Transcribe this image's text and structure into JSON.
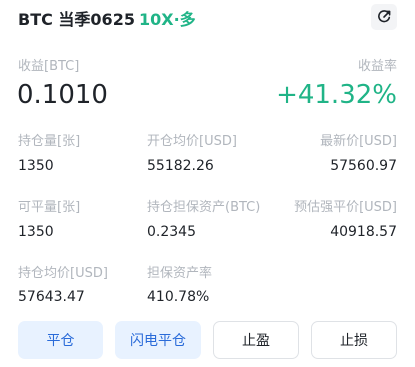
{
  "header": {
    "contract": "BTC 当季0625",
    "tag": "10X·多",
    "share_icon": "share-icon"
  },
  "pnl": {
    "label": "收益[BTC]",
    "value": "0.1010",
    "rate_label": "收益率",
    "rate_value": "+41.32%"
  },
  "row1": {
    "position_label": "持仓量[张]",
    "position_value": "1350",
    "avg_open_label": "开仓均价[USD]",
    "avg_open_value": "55182.26",
    "last_label": "最新价[USD]",
    "last_value": "57560.97"
  },
  "row2": {
    "closable_label": "可平量[张]",
    "closable_value": "1350",
    "margin_label": "持仓担保资产(BTC)",
    "margin_value": "0.2345",
    "liq_label": "预估强平价[USD]",
    "liq_value": "40918.57"
  },
  "row3": {
    "hold_avg_label": "持仓均价[USD]",
    "hold_avg_value": "57643.47",
    "margin_rate_label": "担保资产率",
    "margin_rate_value": "410.78%"
  },
  "actions": {
    "close": "平仓",
    "flash_close": "闪电平仓",
    "take_profit": "止盈",
    "stop_loss": "止损"
  },
  "colors": {
    "green": "#20b487",
    "blue": "#2a6bd9",
    "label_gray": "#b1b6bd"
  }
}
